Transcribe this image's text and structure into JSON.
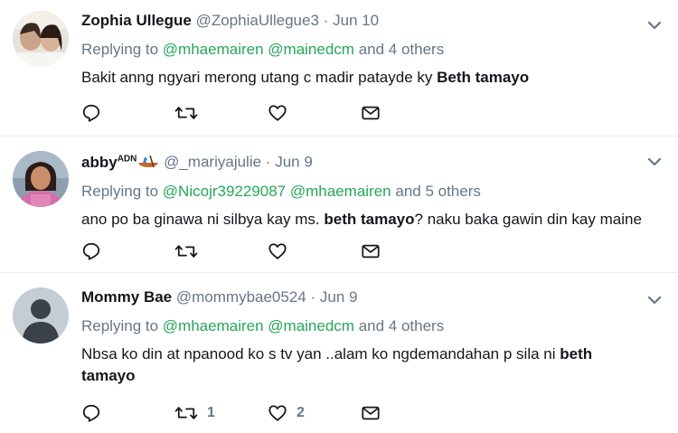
{
  "tweets": [
    {
      "name": "Zophia Ullegue",
      "handle": "@ZophiaUllegue3",
      "date": "Jun 10",
      "replying_label": "Replying to",
      "mentions": [
        "@mhaemairen",
        "@mainedcm"
      ],
      "and_others": "and 4 others",
      "text_plain": "Bakit anng ngyari merong utang c madir patayde ky ",
      "text_bold": "Beth tamayo",
      "text_tail": "",
      "retweets": "",
      "likes": ""
    },
    {
      "name": "abby",
      "name_badge": "ADN",
      "handle": "@_mariyajulie",
      "date": "Jun 9",
      "replying_label": "Replying to",
      "mentions": [
        "@Nicojr39229087",
        "@mhaemairen"
      ],
      "and_others": "and 5 others",
      "text_plain": "ano po ba ginawa ni silbya kay ms. ",
      "text_bold": "beth tamayo",
      "text_tail": "? naku baka gawin din kay maine",
      "retweets": "",
      "likes": ""
    },
    {
      "name": "Mommy Bae",
      "handle": "@mommybae0524",
      "date": "Jun 9",
      "replying_label": "Replying to",
      "mentions": [
        "@mhaemairen",
        "@mainedcm"
      ],
      "and_others": "and 4 others",
      "text_plain": "Nbsa ko din at npanood ko s tv yan ..alam ko ngdemandahan p sila ni ",
      "text_bold": "beth tamayo",
      "text_tail": "",
      "retweets": "1",
      "likes": "2"
    }
  ],
  "dot": "·",
  "icons": {
    "reply": "reply-icon",
    "retweet": "retweet-icon",
    "like": "heart-icon",
    "dm": "envelope-icon",
    "more": "chevron-down-icon",
    "badge": "canoe-emoji-icon"
  },
  "colors": {
    "mention": "#26a65b",
    "meta": "#657786",
    "divider": "#e6ecf0"
  }
}
